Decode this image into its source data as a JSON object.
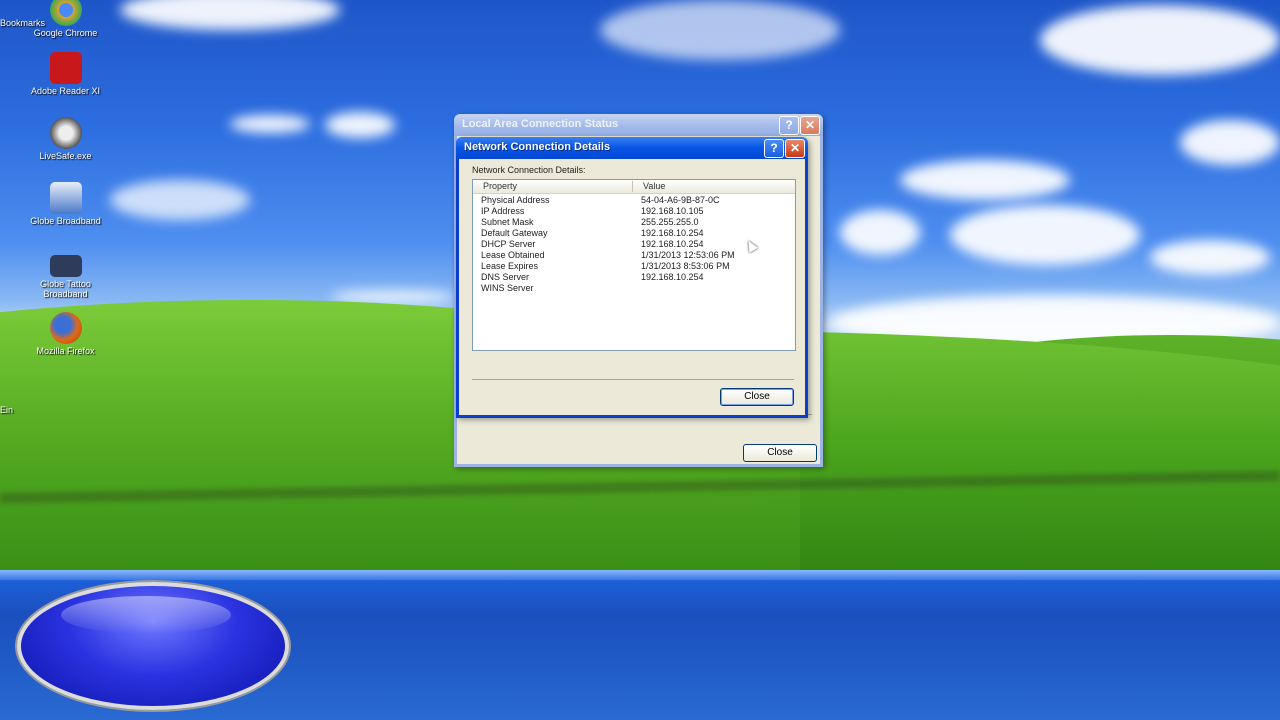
{
  "desktop": {
    "icons": [
      {
        "label": "Google Chrome",
        "color": "#d9a32c"
      },
      {
        "label": "Adobe Reader XI",
        "color": "#c8181b"
      },
      {
        "label": "LiveSafe.exe",
        "color": "#555555"
      },
      {
        "label": "Globe Broadband",
        "color": "#4a78c8"
      },
      {
        "label": "Globe Tattoo Broadband",
        "color": "#2f3b5a"
      },
      {
        "label": "Mozilla Firefox",
        "color": "#e06a17"
      }
    ],
    "edge_labels": [
      "Bookmarks",
      "Ein"
    ]
  },
  "status_window": {
    "title": "Local Area Connection Status",
    "close_label": "Close"
  },
  "details_dialog": {
    "title": "Network Connection Details",
    "section_label": "Network Connection Details:",
    "columns": [
      "Property",
      "Value"
    ],
    "rows": [
      {
        "property": "Physical Address",
        "value": "54-04-A6-9B-87-0C"
      },
      {
        "property": "IP Address",
        "value": "192.168.10.105"
      },
      {
        "property": "Subnet Mask",
        "value": "255.255.255.0"
      },
      {
        "property": "Default Gateway",
        "value": "192.168.10.254"
      },
      {
        "property": "DHCP Server",
        "value": "192.168.10.254"
      },
      {
        "property": "Lease Obtained",
        "value": "1/31/2013 12:53:06 PM"
      },
      {
        "property": "Lease Expires",
        "value": "1/31/2013 8:53:06 PM"
      },
      {
        "property": "DNS Server",
        "value": "192.168.10.254"
      },
      {
        "property": "WINS Server",
        "value": ""
      }
    ],
    "close_label": "Close"
  },
  "colors": {
    "titlebar_active": "#0a58e8",
    "window_face": "#ece9d8",
    "orb": "#2a33e0"
  }
}
